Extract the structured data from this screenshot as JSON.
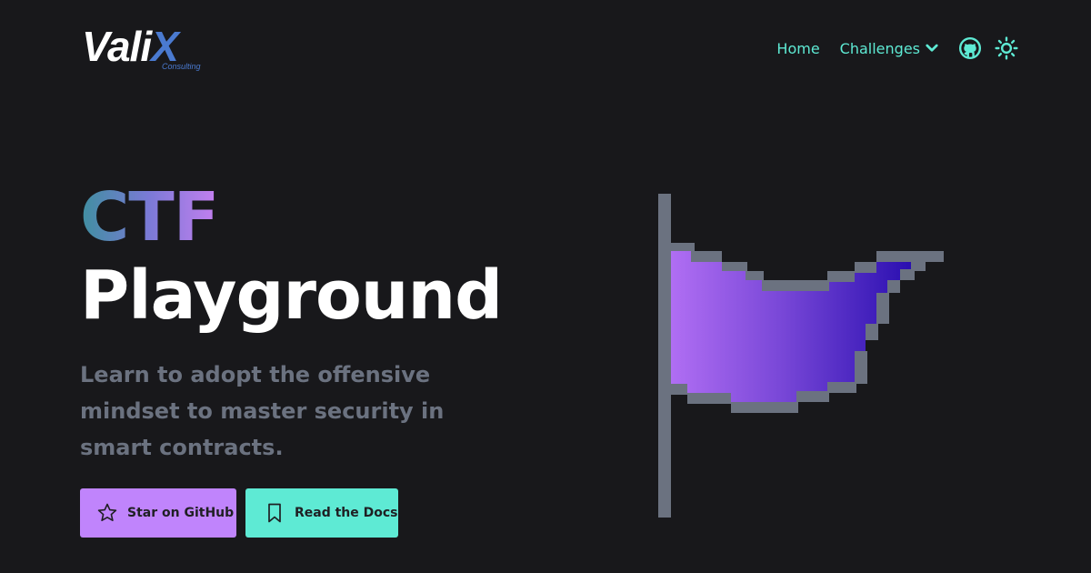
{
  "brand": {
    "name": "Vali",
    "name_accent": "X",
    "subtitle": "Consulting"
  },
  "nav": {
    "home": "Home",
    "challenges": "Challenges",
    "icons": [
      "chevron-down-icon",
      "github-icon",
      "sun-icon"
    ]
  },
  "hero": {
    "title_line1": "CTF",
    "title_line2": "Playground",
    "subtitle": "Learn to adopt the offensive mindset to master security in smart contracts."
  },
  "buttons": {
    "star": {
      "label": "Star on GitHub",
      "icon": "star-icon"
    },
    "docs": {
      "label": "Read the Docs",
      "icon": "bookmark-icon"
    }
  },
  "colors": {
    "background": "#18181b",
    "accent_teal": "#5eead4",
    "accent_purple": "#c084fc",
    "muted_text": "#6b7280",
    "logo_blue": "#4a7ad0",
    "flag_pole": "#6b7280",
    "flag_gradient": [
      "#b06ef3",
      "#2a0fb0"
    ]
  }
}
